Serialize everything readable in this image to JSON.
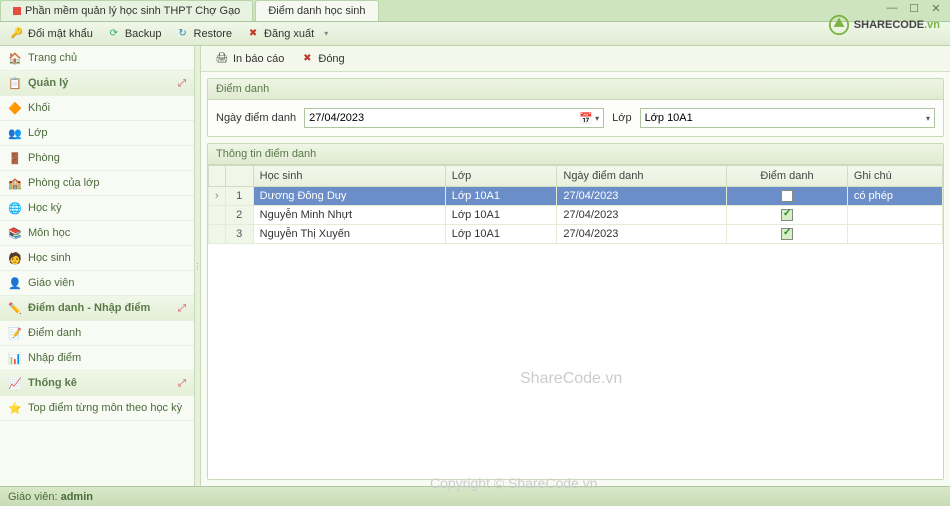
{
  "tabs": [
    {
      "label": "Phần mềm quản lý học sinh THPT Chợ Gạo",
      "active": false
    },
    {
      "label": "Điểm danh học sinh",
      "active": true
    }
  ],
  "toolbar": {
    "change_pw": "Đổi mật khẩu",
    "backup": "Backup",
    "restore": "Restore",
    "logout": "Đăng xuất"
  },
  "sidebar": {
    "home": "Trang chủ",
    "manage_group": "Quản lý",
    "items_manage": [
      "Khối",
      "Lớp",
      "Phòng",
      "Phòng của lớp",
      "Học kỳ",
      "Môn học",
      "Học sinh",
      "Giáo viên"
    ],
    "attendance_group": "Điểm danh - Nhập điểm",
    "items_attendance": [
      "Điểm danh",
      "Nhập điểm"
    ],
    "stats_group": "Thống kê",
    "items_stats": [
      "Top điểm từng môn theo học kỳ"
    ]
  },
  "content_toolbar": {
    "print": "In báo cáo",
    "close": "Đóng"
  },
  "filter": {
    "panel_title": "Điểm danh",
    "date_label": "Ngày điểm danh",
    "date_value": "27/04/2023",
    "class_label": "Lớp",
    "class_value": "Lớp 10A1"
  },
  "grid": {
    "panel_title": "Thông tin điểm danh",
    "cols": {
      "student": "Học sinh",
      "class": "Lớp",
      "date": "Ngày điểm danh",
      "att": "Điểm danh",
      "note": "Ghi chú"
    },
    "rows": [
      {
        "n": "1",
        "student": "Dương Đông Duy",
        "class": "Lớp 10A1",
        "date": "27/04/2023",
        "att": false,
        "note": "có phép",
        "sel": true
      },
      {
        "n": "2",
        "student": "Nguyễn Minh Nhựt",
        "class": "Lớp 10A1",
        "date": "27/04/2023",
        "att": true,
        "note": "",
        "sel": false
      },
      {
        "n": "3",
        "student": "Nguyễn Thị Xuyến",
        "class": "Lớp 10A1",
        "date": "27/04/2023",
        "att": true,
        "note": "",
        "sel": false
      }
    ]
  },
  "status": {
    "user_label": "Giáo viên:",
    "user": "admin"
  },
  "watermark1": "ShareCode.vn",
  "watermark2": "Copyright © ShareCode.vn",
  "logo": {
    "t1": "SHARE",
    "t2": "CODE",
    "t3": ".vn"
  }
}
